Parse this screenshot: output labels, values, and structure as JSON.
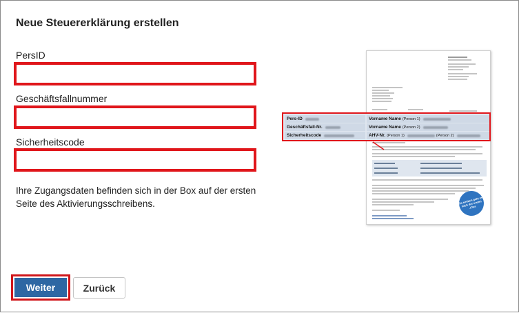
{
  "title": "Neue Steuererklärung erstellen",
  "fields": {
    "persid": {
      "label": "PersID",
      "value": "",
      "placeholder": ""
    },
    "geschaeftsfallnummer": {
      "label": "Geschäftsfallnummer",
      "value": "",
      "placeholder": ""
    },
    "sicherheitscode": {
      "label": "Sicherheitscode",
      "value": "",
      "placeholder": ""
    }
  },
  "hint": "Ihre Zugangsdaten befinden sich in der Box auf der ersten Seite des Aktivierungsschreibens.",
  "buttons": {
    "weiter": "Weiter",
    "zurueck": "Zurück"
  },
  "letter_preview": {
    "rows": [
      {
        "key": "Pers-ID",
        "name_label": "Vorname Name",
        "person": "(Person 1)"
      },
      {
        "key": "Geschäftsfall-Nr.",
        "name_label": "Vorname Name",
        "person": "(Person 2)"
      },
      {
        "key": "Sicherheitscode",
        "name_label": "AHV-Nr.",
        "person": "(Person 1)",
        "person2": "(Person 2)"
      }
    ],
    "seal_text": "So einfach geht es nach der ersten .eTax"
  },
  "colors": {
    "highlight_red": "#e0161b",
    "primary_blue": "#2e67a3",
    "table_blue": "#dfe6ef"
  }
}
